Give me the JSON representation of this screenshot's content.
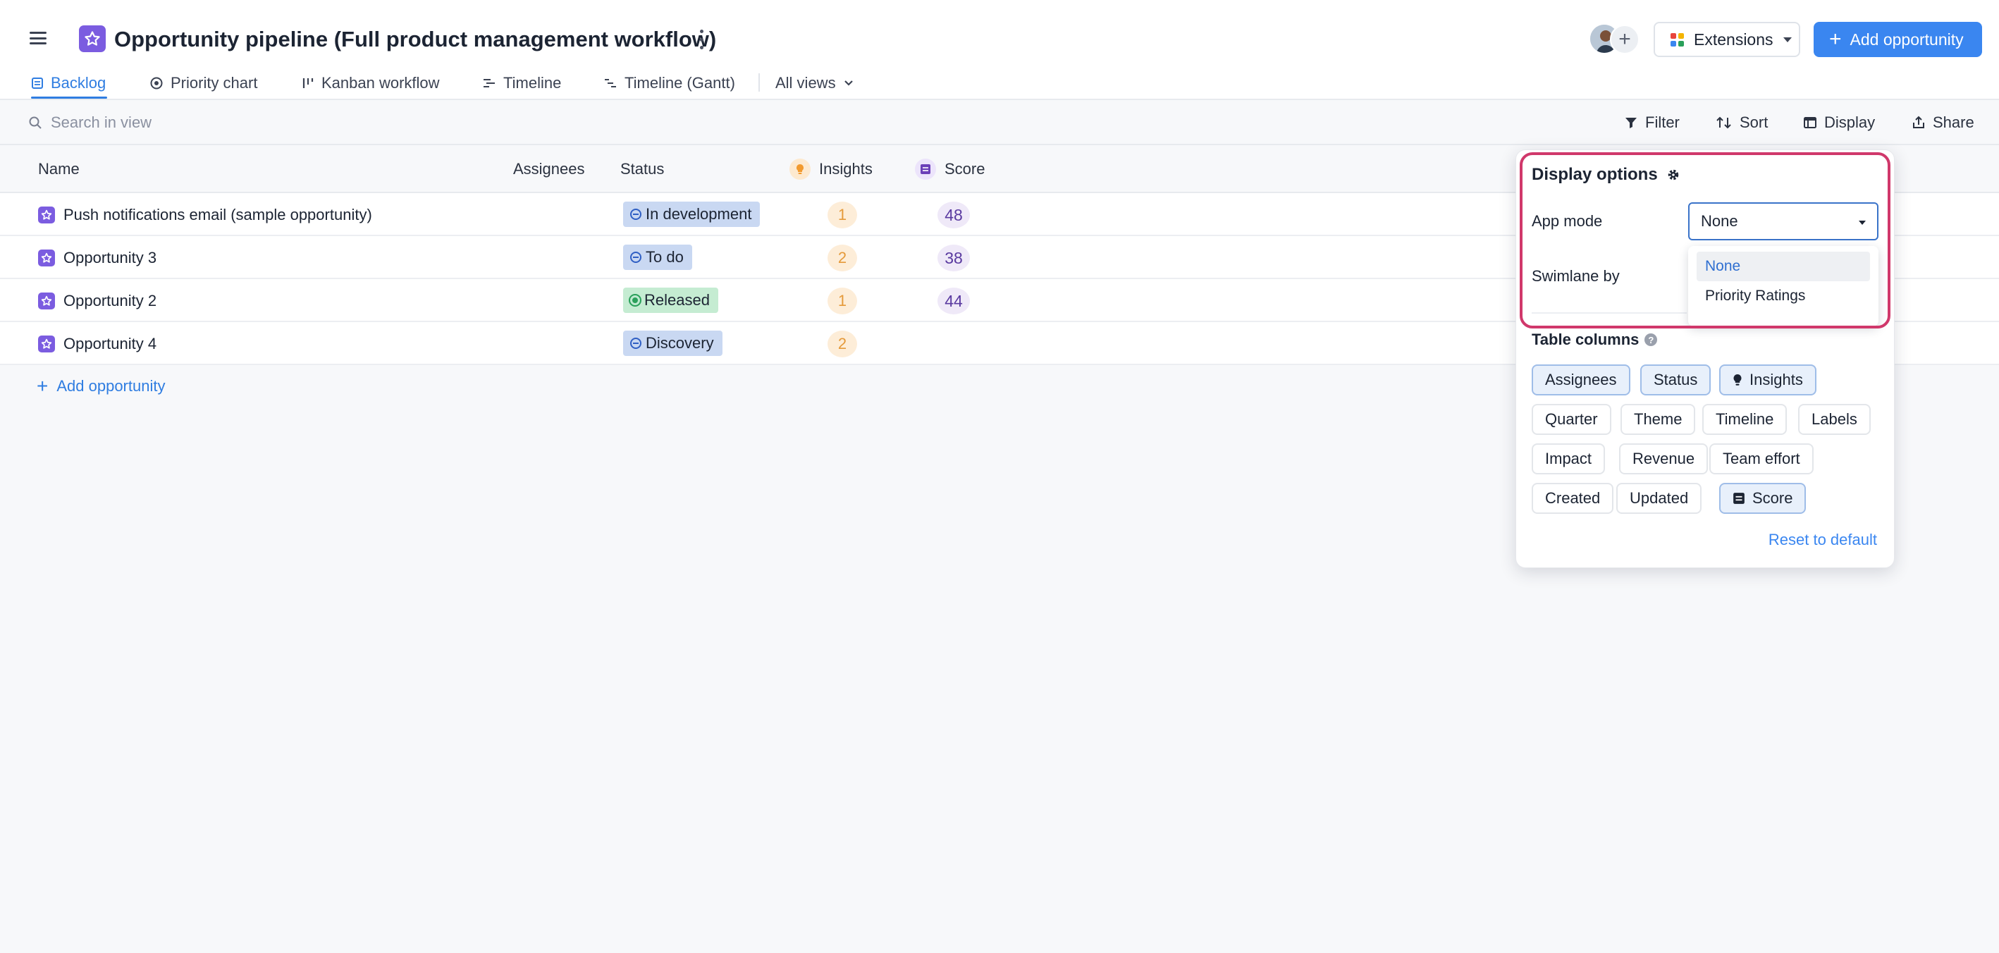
{
  "header": {
    "title": "Opportunity pipeline (Full product management workflow)",
    "extensions_label": "Extensions",
    "add_button_label": "Add opportunity",
    "accent_color": "#3a86f0",
    "page_icon": "star-icon"
  },
  "tabs": [
    {
      "label": "Backlog",
      "icon": "table-icon",
      "active": true
    },
    {
      "label": "Priority chart",
      "icon": "target-icon",
      "active": false
    },
    {
      "label": "Kanban workflow",
      "icon": "kanban-icon",
      "active": false
    },
    {
      "label": "Timeline",
      "icon": "timeline-icon",
      "active": false
    },
    {
      "label": "Timeline (Gantt)",
      "icon": "gantt-icon",
      "active": false
    },
    {
      "label": "All views",
      "icon": "chevron-down-icon",
      "active": false
    }
  ],
  "toolbar": {
    "search_placeholder": "Search in view",
    "filter_label": "Filter",
    "sort_label": "Sort",
    "display_label": "Display",
    "share_label": "Share"
  },
  "table": {
    "columns": {
      "name": "Name",
      "assignees": "Assignees",
      "status": "Status",
      "insights": "Insights",
      "score": "Score"
    },
    "rows": [
      {
        "name": "Push notifications email (sample opportunity)",
        "status": "In development",
        "status_color": "blue",
        "insights": "1",
        "score": "48"
      },
      {
        "name": "Opportunity 3",
        "status": "To do",
        "status_color": "blue",
        "insights": "2",
        "score": "38"
      },
      {
        "name": "Opportunity 2",
        "status": "Released",
        "status_color": "green",
        "insights": "1",
        "score": "44"
      },
      {
        "name": "Opportunity 4",
        "status": "Discovery",
        "status_color": "blue",
        "insights": "2",
        "score": ""
      }
    ],
    "add_row_label": "Add opportunity"
  },
  "display_panel": {
    "title": "Display options",
    "app_mode_label": "App mode",
    "app_mode_value": "None",
    "app_mode_options": [
      "None",
      "Priority Ratings"
    ],
    "swimlane_label": "Swimlane by",
    "columns_label": "Table columns",
    "chips": [
      {
        "label": "Assignees",
        "on": true
      },
      {
        "label": "Status",
        "on": true
      },
      {
        "label": "Insights",
        "on": true
      },
      {
        "label": "Quarter",
        "on": false
      },
      {
        "label": "Theme",
        "on": false
      },
      {
        "label": "Timeline",
        "on": false
      },
      {
        "label": "Labels",
        "on": false
      },
      {
        "label": "Impact",
        "on": false
      },
      {
        "label": "Revenue",
        "on": false
      },
      {
        "label": "Team effort",
        "on": false
      },
      {
        "label": "Created",
        "on": false
      },
      {
        "label": "Updated",
        "on": false
      },
      {
        "label": "Score",
        "on": true
      }
    ],
    "reset_label": "Reset to default",
    "highlight_color": "#d0386b"
  }
}
